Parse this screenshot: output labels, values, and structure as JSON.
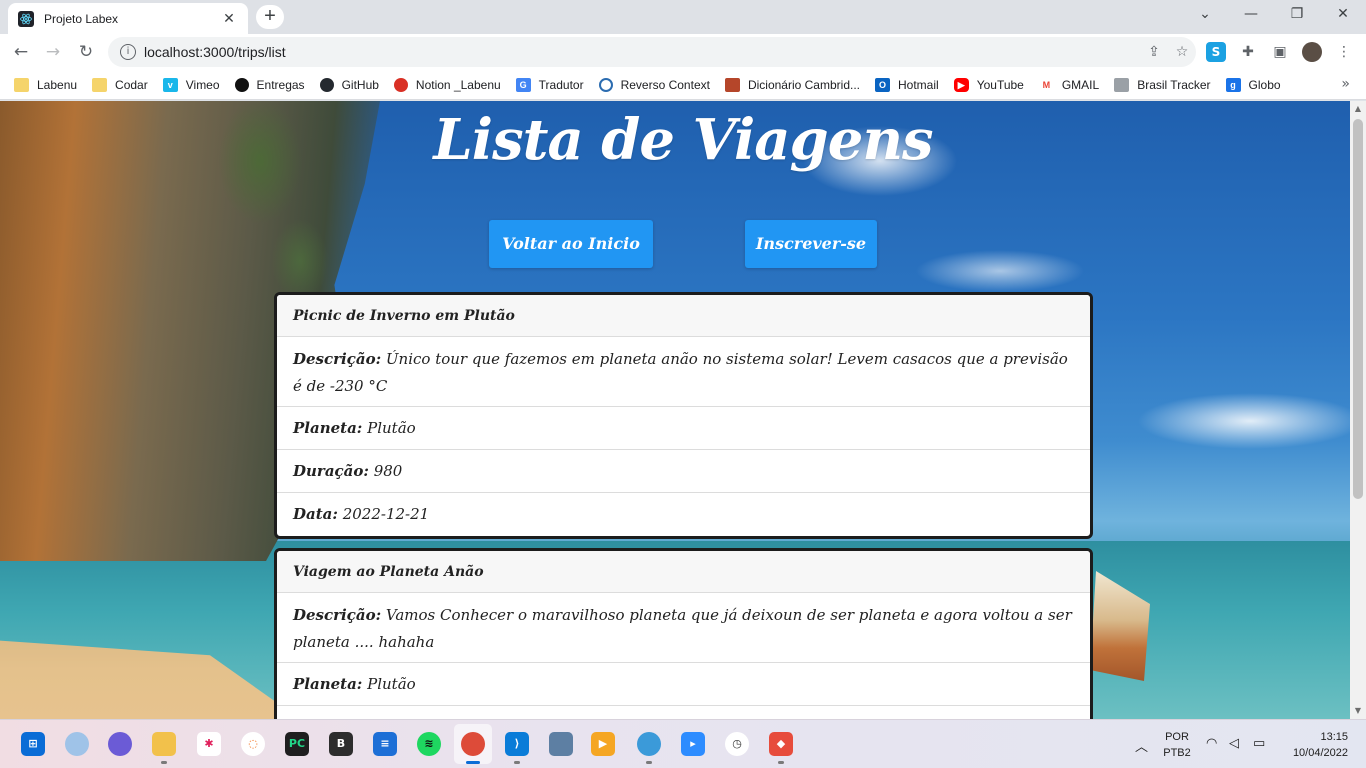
{
  "browser": {
    "tab_title": "Projeto Labex",
    "tab_close": "✕",
    "new_tab": "+",
    "url": "localhost:3000/trips/list",
    "window_controls": {
      "minimize": "—",
      "maximize": "❐",
      "close": "✕",
      "tab_search": "⌄"
    }
  },
  "bookmarks": [
    {
      "label": "Labenu",
      "icon": "folder-icon",
      "color": "#f5d46b"
    },
    {
      "label": "Codar",
      "icon": "folder-icon",
      "color": "#f5d46b"
    },
    {
      "label": "Vimeo",
      "icon": "vimeo-icon",
      "color": "#1ab7ea"
    },
    {
      "label": "Entregas",
      "icon": "circle-icon",
      "color": "#111111"
    },
    {
      "label": "GitHub",
      "icon": "github-icon",
      "color": "#24292f"
    },
    {
      "label": "Notion _Labenu",
      "icon": "apple-icon",
      "color": "#d93025"
    },
    {
      "label": "Tradutor",
      "icon": "translate-icon",
      "color": "#4285f4"
    },
    {
      "label": "Reverso Context",
      "icon": "reverso-icon",
      "color": "#2b6cb0"
    },
    {
      "label": "Dicionário Cambrid...",
      "icon": "cambridge-icon",
      "color": "#b5462a"
    },
    {
      "label": "Hotmail",
      "icon": "outlook-icon",
      "color": "#0a64c2"
    },
    {
      "label": "YouTube",
      "icon": "youtube-icon",
      "color": "#ff0000"
    },
    {
      "label": "GMAIL",
      "icon": "gmail-icon",
      "color": "#ea4335"
    },
    {
      "label": "Brasil Tracker",
      "icon": "lock-icon",
      "color": "#9aa0a6"
    },
    {
      "label": "Globo",
      "icon": "globo-icon",
      "color": "#1a73e8"
    }
  ],
  "page": {
    "title": "Lista de Viagens",
    "back_button": "Voltar ao Inicio",
    "subscribe_button": "Inscrever-se"
  },
  "trips": [
    {
      "name": "Picnic de Inverno em Plutão",
      "description_label": "Descrição:",
      "description": "Único tour que fazemos em planeta anão no sistema solar! Levem casacos que a previsão é de -230 °C",
      "planet_label": "Planeta:",
      "planet": "Plutão",
      "duration_label": "Duração:",
      "duration": "980",
      "date_label": "Data:",
      "date": "2022-12-21"
    },
    {
      "name": "Viagem ao Planeta Anão",
      "description_label": "Descrição:",
      "description": "Vamos Conhecer o maravilhoso planeta que já deixoun de ser planeta e agora voltou a ser planeta .... hahaha",
      "planet_label": "Planeta:",
      "planet": "Plutão"
    }
  ],
  "taskbar": {
    "language": "POR",
    "layout": "PTB2",
    "time": "13:15",
    "date": "10/04/2022",
    "accent_color": "#2196f3"
  }
}
